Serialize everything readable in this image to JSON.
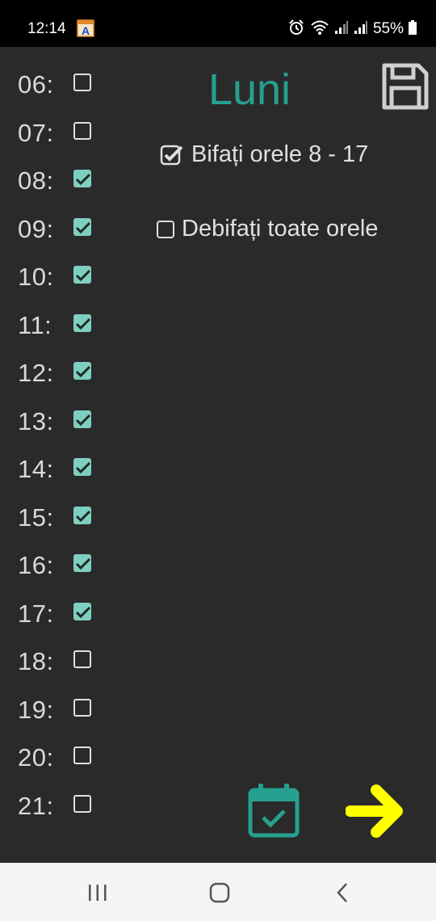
{
  "status_bar": {
    "time": "12:14",
    "battery_text": "55%",
    "icons": [
      "app-notification-icon",
      "alarm-icon",
      "wifi-icon",
      "signal-icon",
      "signal-icon",
      "battery-icon"
    ]
  },
  "header": {
    "day_title": "Luni"
  },
  "options": {
    "check_8_17_label": "Bifați orele 8 - 17",
    "check_8_17_checked": true,
    "uncheck_all_label": "Debifați toate orele",
    "uncheck_all_checked": false
  },
  "hours": [
    {
      "label": "06:",
      "checked": false
    },
    {
      "label": "07:",
      "checked": false
    },
    {
      "label": "08:",
      "checked": true
    },
    {
      "label": "09:",
      "checked": true
    },
    {
      "label": "10:",
      "checked": true
    },
    {
      "label": "11:",
      "checked": true
    },
    {
      "label": "12:",
      "checked": true
    },
    {
      "label": "13:",
      "checked": true
    },
    {
      "label": "14:",
      "checked": true
    },
    {
      "label": "15:",
      "checked": true
    },
    {
      "label": "16:",
      "checked": true
    },
    {
      "label": "17:",
      "checked": true
    },
    {
      "label": "18:",
      "checked": false
    },
    {
      "label": "19:",
      "checked": false
    },
    {
      "label": "20:",
      "checked": false
    },
    {
      "label": "21:",
      "checked": false
    }
  ],
  "colors": {
    "background": "#2a2a2a",
    "accent": "#26a08f",
    "checkbox_checked": "#7fcfc0",
    "arrow": "#ffff00",
    "text": "#d9d9d9"
  },
  "bottom_actions": [
    "calendar-check-icon",
    "arrow-right-icon"
  ],
  "nav_bar": [
    "recents-icon",
    "home-icon",
    "back-icon"
  ]
}
